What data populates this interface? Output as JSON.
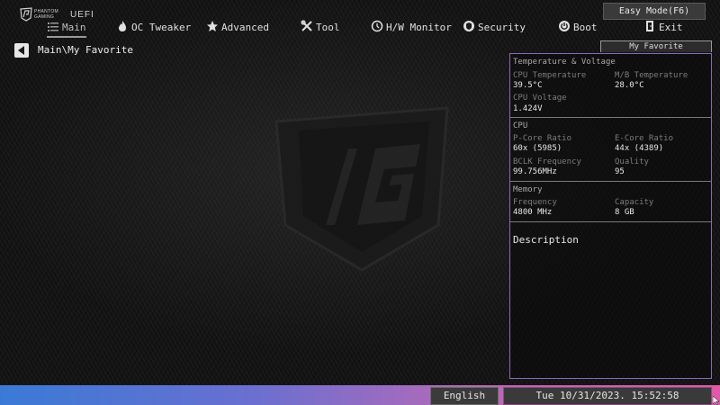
{
  "header": {
    "brand_line1": "PHANTOM",
    "brand_line2": "GAMING",
    "uefi_label": "UEFI",
    "easy_mode_label": "Easy Mode(F6)"
  },
  "nav": {
    "items": [
      {
        "label": "Main",
        "icon": "list-icon",
        "active": true
      },
      {
        "label": "OC Tweaker",
        "icon": "flame-icon"
      },
      {
        "label": "Advanced",
        "icon": "star-icon"
      },
      {
        "label": "Tool",
        "icon": "tools-icon"
      },
      {
        "label": "H/W Monitor",
        "icon": "monitor-icon"
      },
      {
        "label": "Security",
        "icon": "shield-icon"
      },
      {
        "label": "Boot",
        "icon": "power-icon"
      },
      {
        "label": "Exit",
        "icon": "exit-door-icon"
      }
    ]
  },
  "breadcrumb": "Main\\My Favorite",
  "panel": {
    "tab_label": "My Favorite",
    "temperature_voltage": {
      "title": "Temperature & Voltage",
      "cpu_temp_label": "CPU Temperature",
      "cpu_temp_value": "39.5°C",
      "mb_temp_label": "M/B Temperature",
      "mb_temp_value": "28.0°C",
      "cpu_voltage_label": "CPU Voltage",
      "cpu_voltage_value": "1.424V"
    },
    "cpu": {
      "title": "CPU",
      "pcore_label": "P-Core Ratio",
      "pcore_value": "60x (5985)",
      "ecore_label": "E-Core Ratio",
      "ecore_value": "44x (4389)",
      "bclk_label": "BCLK Frequency",
      "bclk_value": "99.756MHz",
      "quality_label": "Quality",
      "quality_value": "95"
    },
    "memory": {
      "title": "Memory",
      "frequency_label": "Frequency",
      "frequency_value": "4800 MHz",
      "capacity_label": "Capacity",
      "capacity_value": "8 GB"
    },
    "description_title": "Description"
  },
  "footer": {
    "language_label": "English",
    "datetime": "Tue 10/31/2023. 15:52:58"
  },
  "colors": {
    "panel_border": "#8a6ab8",
    "bottom_left": "#3a7ad6",
    "bottom_right": "#e05aa8"
  }
}
